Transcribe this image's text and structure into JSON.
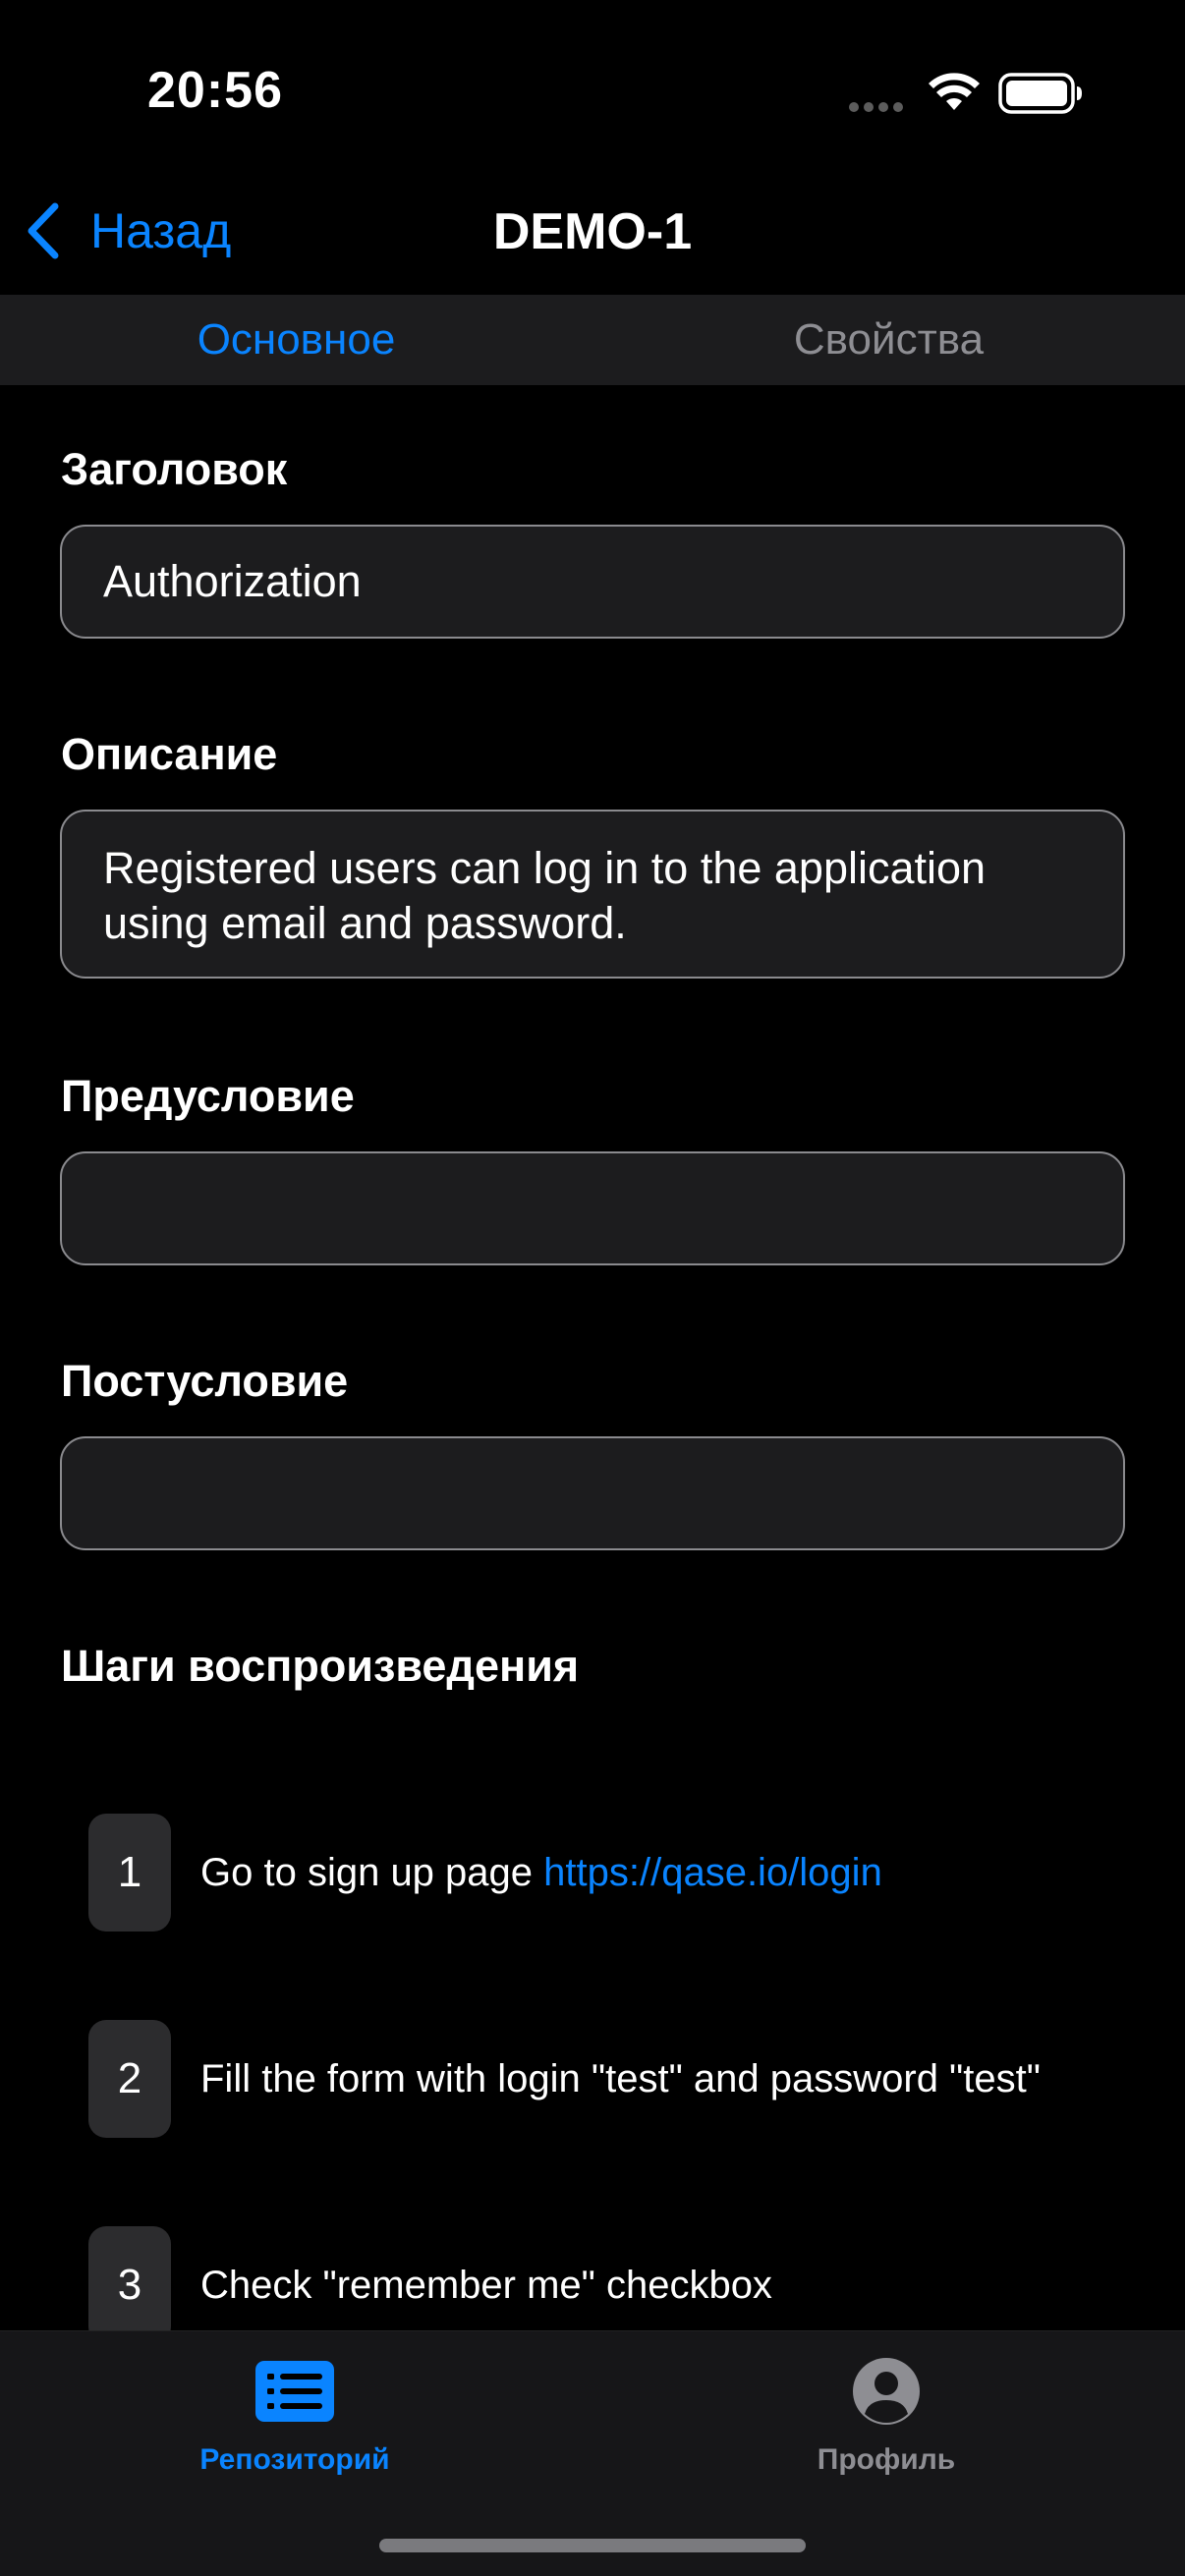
{
  "status_bar": {
    "time": "20:56"
  },
  "nav": {
    "back_label": "Назад",
    "title": "DEMO-1"
  },
  "tabs": [
    {
      "label": "Основное",
      "active": true
    },
    {
      "label": "Свойства",
      "active": false
    }
  ],
  "form": {
    "title": {
      "label": "Заголовок",
      "value": "Authorization"
    },
    "description": {
      "label": "Описание",
      "value": "Registered users can log in to the application using email and password."
    },
    "precondition": {
      "label": "Предусловие",
      "value": ""
    },
    "postcondition": {
      "label": "Постусловие",
      "value": ""
    }
  },
  "steps_section": {
    "heading": "Шаги воспроизведения",
    "steps": [
      {
        "number": "1",
        "text": "Go to sign up page ",
        "link": "https://qase.io/login"
      },
      {
        "number": "2",
        "text": "Fill the form with login \"test\" and password \"test\""
      },
      {
        "number": "3",
        "text": "Check \"remember me\" checkbox"
      }
    ]
  },
  "tab_bar": {
    "items": [
      {
        "label": "Репозиторий",
        "icon": "list-icon",
        "active": true
      },
      {
        "label": "Профиль",
        "icon": "person-circle-icon",
        "active": false
      }
    ]
  },
  "colors": {
    "accent": "#0a84ff",
    "inactive": "#8e8e93",
    "background": "#000000",
    "field_background": "#1c1c1e"
  }
}
